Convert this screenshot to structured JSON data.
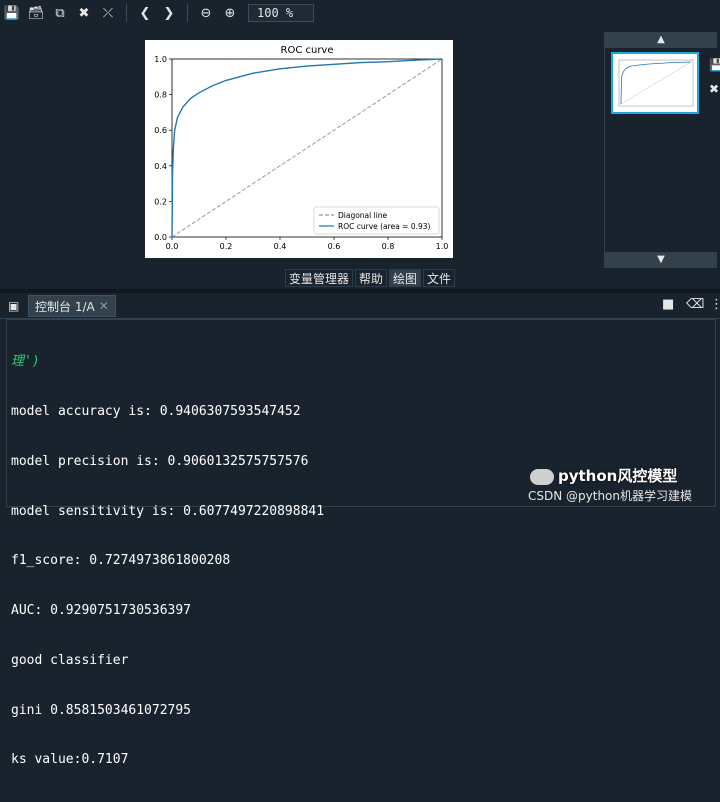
{
  "toolbar": {
    "icons": [
      "save-icon",
      "save-all-icon",
      "copy-icon",
      "close-icon",
      "close-all-icon",
      "back-icon",
      "forward-icon",
      "zoom-out-icon",
      "zoom-in-icon"
    ],
    "zoom_value": "100 %"
  },
  "plot": {
    "title": "ROC curve",
    "legend": [
      "Diagonal line",
      "ROC curve (area = 0.93)"
    ]
  },
  "chart_data": {
    "type": "line",
    "title": "ROC curve",
    "xlabel": "",
    "ylabel": "",
    "xlim": [
      0.0,
      1.0
    ],
    "ylim": [
      0.0,
      1.0
    ],
    "x_ticks": [
      "0.0",
      "0.2",
      "0.4",
      "0.6",
      "0.8",
      "1.0"
    ],
    "y_ticks": [
      "0.0",
      "0.2",
      "0.4",
      "0.6",
      "0.8",
      "1.0"
    ],
    "legend_position": "bottom-right",
    "series": [
      {
        "name": "Diagonal line",
        "style": "dashed",
        "color": "#999999",
        "points": [
          [
            0,
            0
          ],
          [
            1,
            1
          ]
        ]
      },
      {
        "name": "ROC curve (area = 0.93)",
        "style": "solid",
        "color": "#1f77b4",
        "points": [
          [
            0,
            0
          ],
          [
            0.002,
            0.35
          ],
          [
            0.005,
            0.5
          ],
          [
            0.01,
            0.6
          ],
          [
            0.02,
            0.67
          ],
          [
            0.04,
            0.73
          ],
          [
            0.07,
            0.78
          ],
          [
            0.1,
            0.81
          ],
          [
            0.15,
            0.85
          ],
          [
            0.2,
            0.88
          ],
          [
            0.3,
            0.92
          ],
          [
            0.4,
            0.945
          ],
          [
            0.5,
            0.96
          ],
          [
            0.6,
            0.97
          ],
          [
            0.7,
            0.98
          ],
          [
            0.8,
            0.985
          ],
          [
            0.9,
            0.993
          ],
          [
            1.0,
            1.0
          ]
        ]
      }
    ]
  },
  "tabs": [
    {
      "label": "变量管理器",
      "active": false
    },
    {
      "label": "帮助",
      "active": false
    },
    {
      "label": "绘图",
      "active": true
    },
    {
      "label": "文件",
      "active": false
    }
  ],
  "console": {
    "tab_label": "控制台 1/A",
    "first_line": "理')",
    "lines": [
      "model accuracy is: 0.9406307593547452",
      "model precision is: 0.9060132575757576",
      "model sensitivity is: 0.6077497220898841",
      "f1_score: 0.7274973861800208",
      "AUC: 0.9290751730536397",
      "good classifier",
      "gini 0.8581503461072795",
      "ks value:0.7107"
    ]
  },
  "watermark": "python风控模型",
  "credit": "CSDN @python机器学习建模"
}
